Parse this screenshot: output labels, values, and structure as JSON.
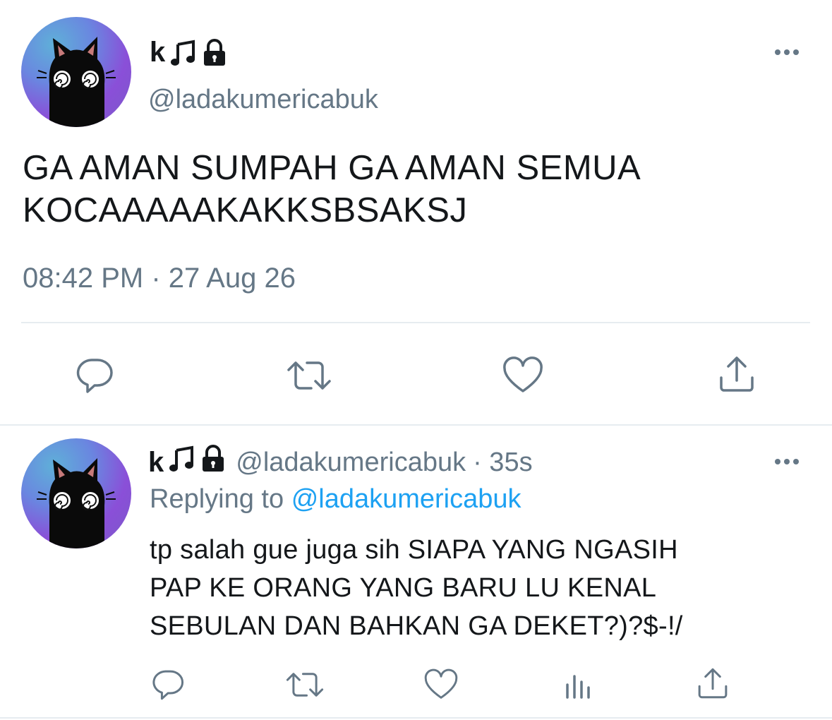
{
  "tweet": {
    "author_name": "k",
    "author_handle": "@ladakumericabuk",
    "name_icons": [
      "music-note-icon",
      "lock-icon"
    ],
    "text_line1": "GA AMAN SUMPAH GA AMAN SEMUA",
    "text_line2": "KOCAAAAAKAKKSBSAKSJ",
    "timestamp": "08:42 PM · 27 Aug 26",
    "actions": [
      "reply-icon",
      "retweet-icon",
      "like-icon",
      "share-icon"
    ]
  },
  "reply": {
    "author_name": "k",
    "author_handle": "@ladakumericabuk",
    "time": "· 35s",
    "replying_prefix": "Replying to",
    "replying_mention": "@ladakumericabuk",
    "text_line1": "tp salah gue juga sih SIAPA YANG NGASIH",
    "text_line2": "PAP KE ORANG YANG BARU LU KENAL",
    "text_line3": "SEBULAN DAN BAHKAN GA DEKET?)?$-!/",
    "actions": [
      "reply-icon",
      "retweet-icon",
      "like-icon",
      "analytics-icon",
      "share-icon"
    ]
  },
  "colors": {
    "text": "#14171a",
    "secondary": "#657786",
    "link": "#1da1f2",
    "divider": "#e6ecf0"
  }
}
